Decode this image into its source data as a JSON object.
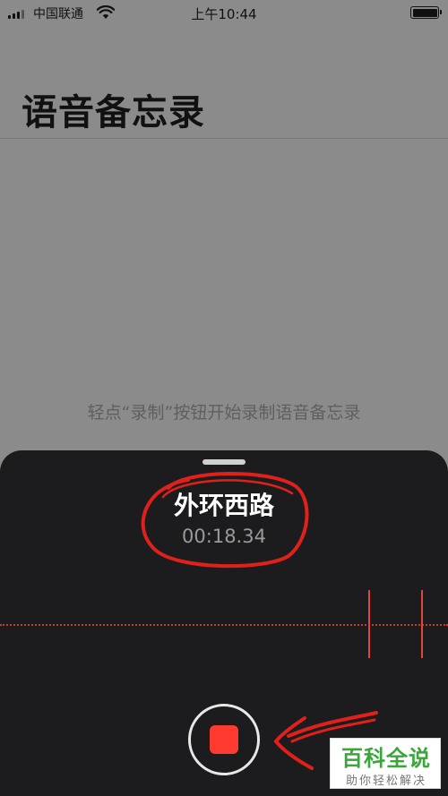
{
  "status_bar": {
    "carrier": "中国联通",
    "time": "上午10:44",
    "icons": [
      "signal-icon",
      "wifi-icon",
      "battery-icon"
    ],
    "battery_level_percent": 100
  },
  "page": {
    "title": "语音备忘录",
    "empty_hint": "轻点“录制”按钮开始录制语音备忘录"
  },
  "recording_panel": {
    "name": "外环西路",
    "elapsed": "00:18.34",
    "record_button_state": "stop",
    "accent_color": "#ff3b30"
  },
  "watermark": {
    "brand": "百科全说",
    "slogan": "助你轻松解决",
    "color": "#3aa63a"
  }
}
